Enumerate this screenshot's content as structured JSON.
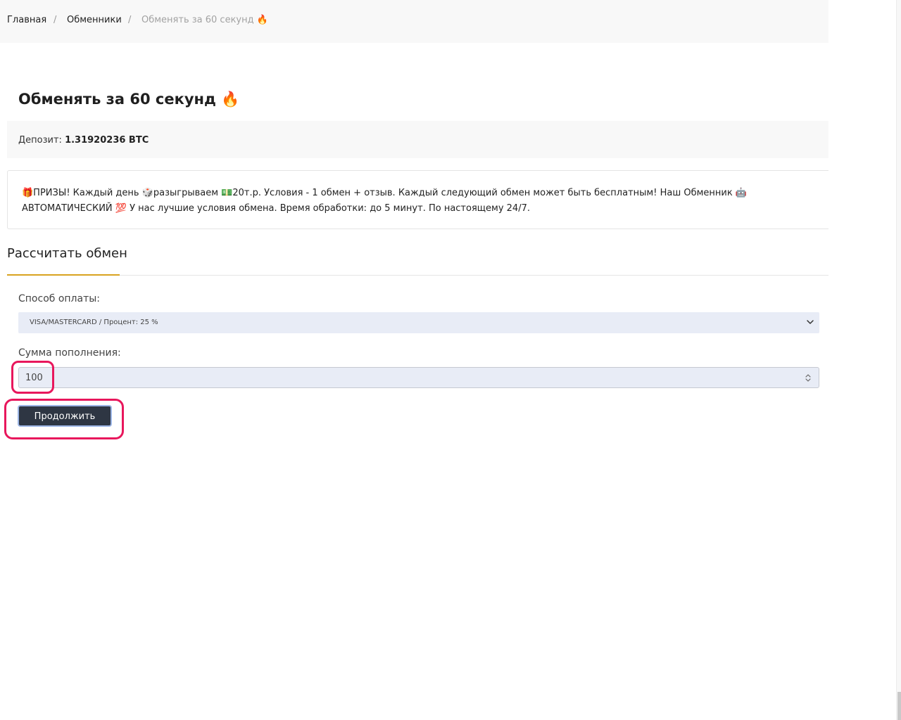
{
  "breadcrumb": {
    "home": "Главная",
    "exchangers": "Обменники",
    "separator": "/",
    "current": "Обменять за 60 секунд 🔥"
  },
  "page": {
    "title": "Обменять за 60 секунд 🔥"
  },
  "deposit": {
    "label": "Депозит:",
    "value": "1.31920236 BTC"
  },
  "notice": {
    "text": "🎁ПРИЗЫ! Каждый день 🎲разыгрываем 💵20т.р. Условия - 1 обмен + отзыв. Каждый следующий обмен может быть бесплатным! Наш Обменник 🤖АВТОМАТИЧЕСКИЙ 💯 У нас лучшие условия обмена. Время обработки: до 5 минут. По настоящему 24/7."
  },
  "calculator": {
    "title": "Рассчитать обмен",
    "payment_label": "Способ оплаты:",
    "payment_selected": "VISA/MASTERCARD / Процент: 25 %",
    "amount_label": "Сумма пополнения:",
    "amount_value": "100",
    "continue_label": "Продолжить"
  },
  "colors": {
    "accent": "#d8a21f",
    "button": "#2e3643",
    "annotation": "#e8175c",
    "input_bg": "#e8ecf6"
  },
  "icons": {
    "select": "chevron-down-icon",
    "spinner": "spinner-arrows-icon"
  }
}
